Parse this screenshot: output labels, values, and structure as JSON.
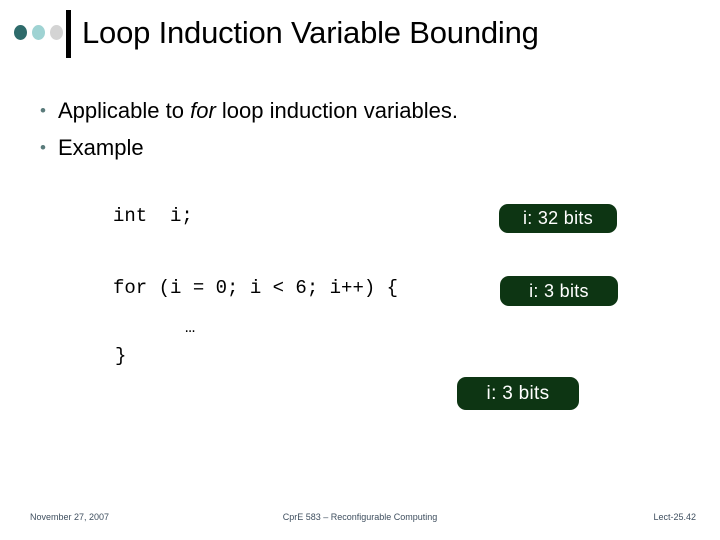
{
  "slide": {
    "title": "Loop Induction Variable Bounding",
    "decoration": {
      "dot_colors": [
        "#2e6b6b",
        "#9fd3d3",
        "#d4d4d4"
      ],
      "rule_color": "#000000"
    },
    "bullets": [
      {
        "marker": "•",
        "prefix": "Applicable to ",
        "emphasis": "for",
        "suffix": " loop induction variables."
      },
      {
        "marker": "•",
        "prefix": "Example",
        "emphasis": "",
        "suffix": ""
      }
    ],
    "code": {
      "declaration": "int  i;",
      "for_statement": "for (i = 0; i < 6; i++) {",
      "body_ellipsis": "…",
      "closing_brace": "}"
    },
    "callouts": [
      {
        "label": "i: 32 bits",
        "color": "#0d3513",
        "text_color": "#ffffff"
      },
      {
        "label": "i: 3 bits",
        "color": "#0d3513",
        "text_color": "#ffffff"
      },
      {
        "label": "i: 3 bits",
        "color": "#0d3513",
        "text_color": "#ffffff"
      }
    ],
    "footer": {
      "date": "November 27, 2007",
      "course": "CprE 583 – Reconfigurable Computing",
      "lecture": "Lect-25.42"
    }
  }
}
